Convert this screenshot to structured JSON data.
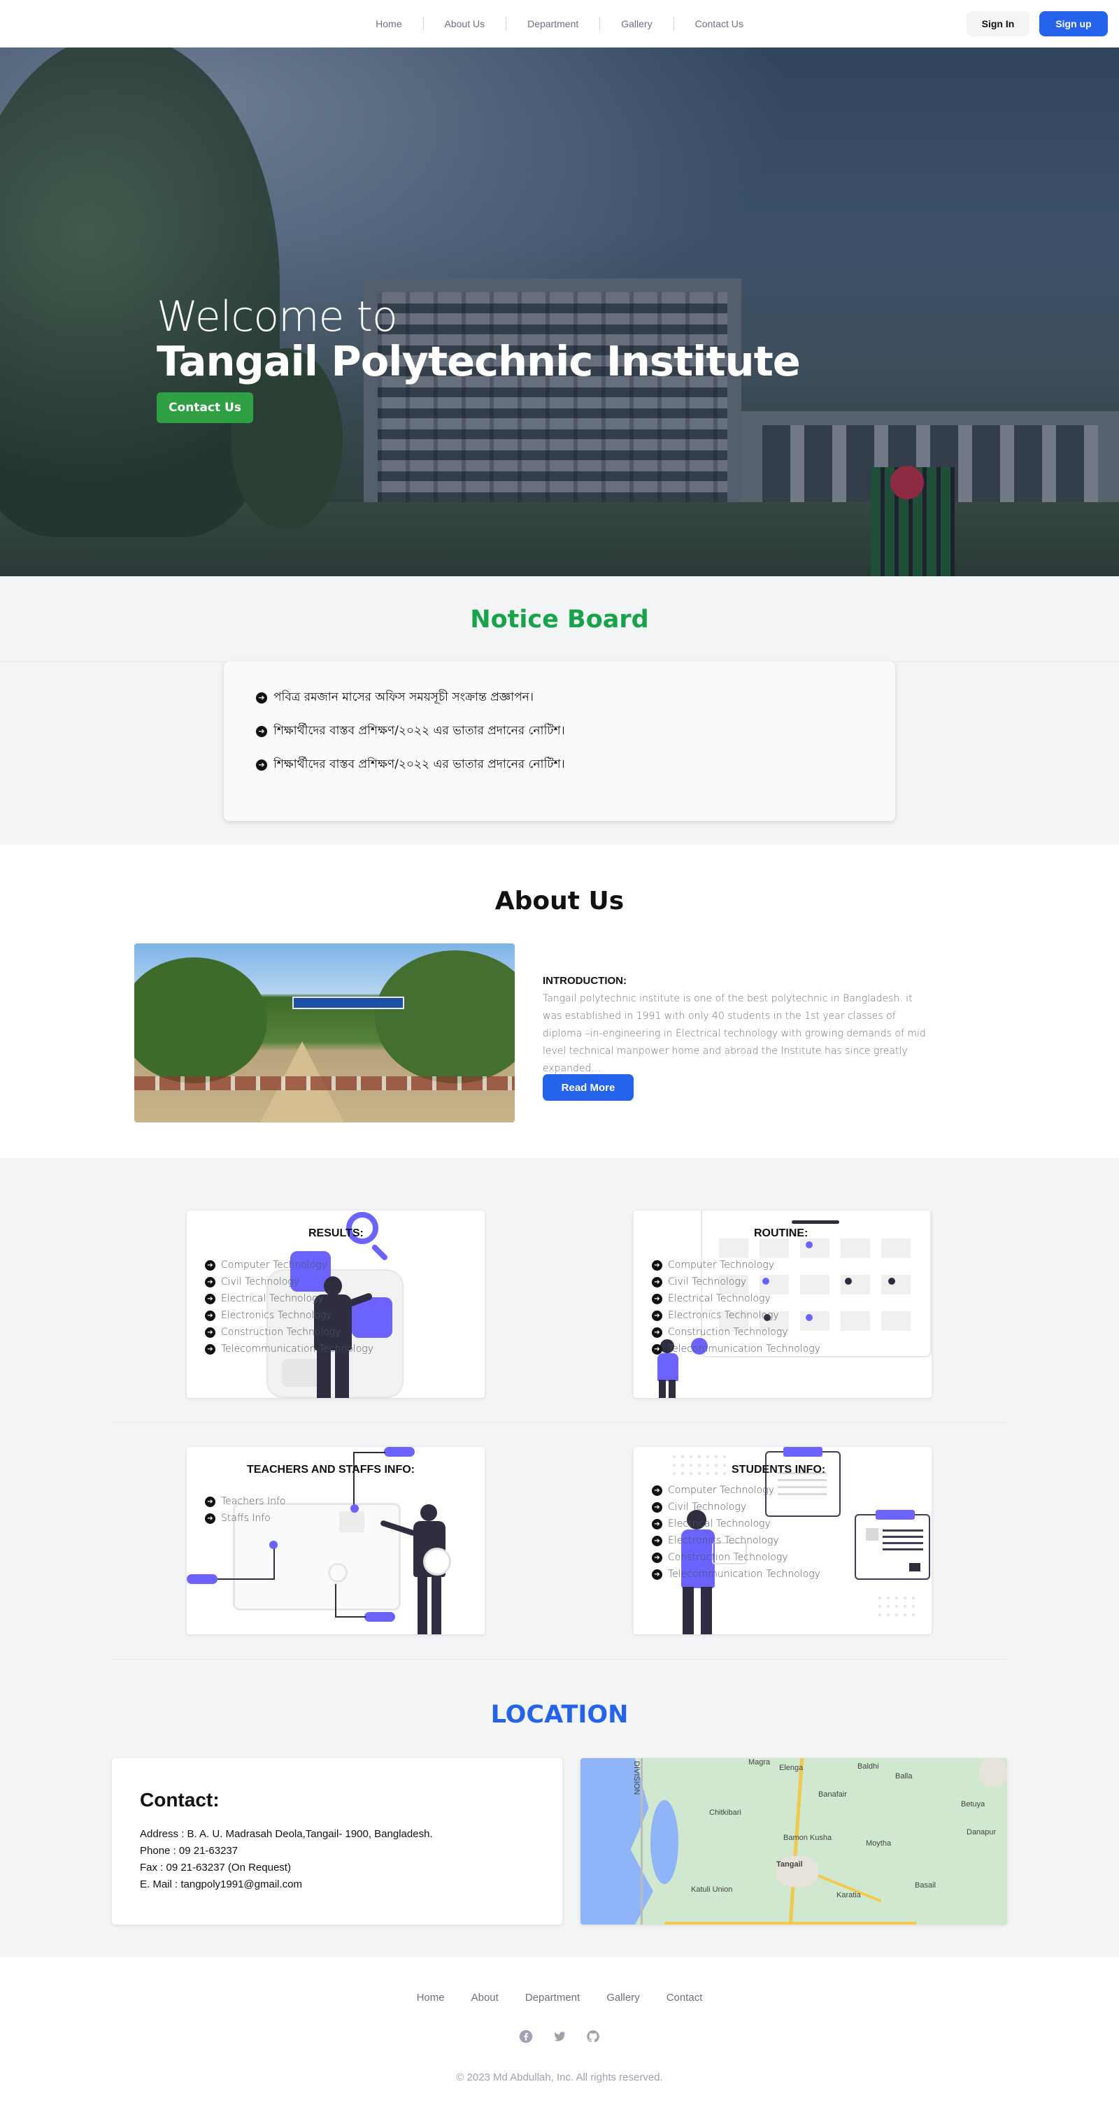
{
  "nav": {
    "links": [
      "Home",
      "About Us",
      "Department",
      "Gallery",
      "Contact Us"
    ],
    "sign_in": "Sign In",
    "sign_up": "Sign up"
  },
  "hero": {
    "welcome": "Welcome to",
    "title": "Tangail Polytechnic Institute",
    "button": "Contact Us"
  },
  "notice": {
    "title": "Notice Board",
    "items": [
      "পবিত্র রমজান মাসের অফিস সময়সূচী সংক্রান্ত প্রজ্ঞাপন।",
      "শিক্ষার্থীদের বাস্তব প্রশিক্ষণ/২০২২ এর ভাতার প্রদানের নোটিশ।",
      "শিক্ষার্থীদের বাস্তব প্রশিক্ষণ/২০২২ এর ভাতার প্রদানের নোটিশ।"
    ]
  },
  "about": {
    "title": "About Us",
    "intro_label": "INTRODUCTION:",
    "text": "Tangail polytechnic institute is one of the best polytechnic in Bangladesh. it was established in 1991 with only 40 students in the 1st year classes of diploma –in-engineering in Electrical technology with growing demands of mid level technical manpower home and abroad the Institute has since greatly expanded...",
    "read_more": "Read More"
  },
  "cards": {
    "results": {
      "title": "RESULTS:",
      "items": [
        "Computer Technology",
        "Civil Technology",
        "Electrical Technology",
        "Electronics Technology",
        "Construction Technology",
        "Telecommunication Technology"
      ]
    },
    "routine": {
      "title": "ROUTINE:",
      "items": [
        "Computer Technology",
        "Civil Technology",
        "Electrical Technology",
        "Electronics Technology",
        "Construction Technology",
        "Telecommunication Technology"
      ]
    },
    "teachers": {
      "title": "TEACHERS AND STAFFS INFO:",
      "items": [
        "Teachers Info",
        "Staffs Info"
      ]
    },
    "students": {
      "title": "STUDENTS INFO:",
      "items": [
        "Computer Technology",
        "Civil Technology",
        "Electrical Technology",
        "Electronics Technology",
        "Construction Technology",
        "Telecommunication Technology"
      ]
    }
  },
  "location": {
    "title": "LOCATION",
    "contact_heading": "Contact:",
    "address": "Address : B. A. U. Madrasah Deola,Tangail- 1900, Bangladesh.",
    "phone": "Phone : 09 21-63237",
    "fax": "Fax : 09 21-63237 (On Request)",
    "email": "E. Mail : tangpoly1991@gmail.com",
    "map_labels": {
      "magra": "Magra",
      "elenga": "Elenga",
      "baldhi": "Baldhi",
      "balla": "Balla",
      "division": "DIVISION",
      "banafair": "Banafair",
      "chitkibari": "Chitkibari",
      "bamon_kusha": "Bamon Kusha",
      "moytha": "Moytha",
      "betuya": "Betuya",
      "danapur": "Danapur",
      "tangail": "Tangail",
      "katuli_union": "Katuli Union",
      "karatia": "Karatia",
      "basail": "Basail"
    }
  },
  "footer": {
    "links": [
      "Home",
      "About",
      "Department",
      "Gallery",
      "Contact"
    ],
    "copyright": "© 2023 Md Abdullah, Inc. All rights reserved."
  },
  "colors": {
    "accent_blue": "#2563eb",
    "notice_green": "#16a34a",
    "hero_button_green": "#2ea043",
    "illustration_purple": "#6c63ff"
  }
}
